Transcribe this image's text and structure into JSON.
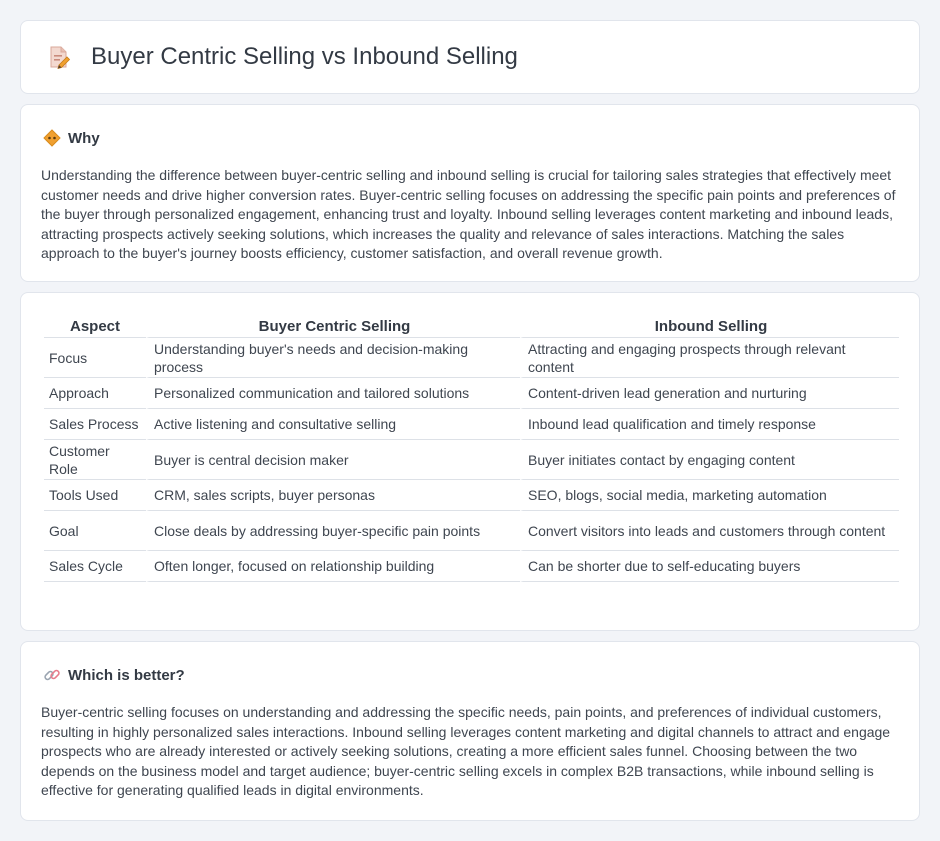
{
  "header": {
    "title": "Buyer Centric Selling vs Inbound Selling",
    "icon": "document-pencil-icon"
  },
  "why": {
    "heading": "Why",
    "icon": "diamond-sign-icon",
    "text": "Understanding the difference between buyer-centric selling and inbound selling is crucial for tailoring sales strategies that effectively meet customer needs and drive higher conversion rates. Buyer-centric selling focuses on addressing the specific pain points and preferences of the buyer through personalized engagement, enhancing trust and loyalty. Inbound selling leverages content marketing and inbound leads, attracting prospects actively seeking solutions, which increases the quality and relevance of sales interactions. Matching the sales approach to the buyer's journey boosts efficiency, customer satisfaction, and overall revenue growth."
  },
  "comparison": {
    "headers": [
      "Aspect",
      "Buyer Centric Selling",
      "Inbound Selling"
    ],
    "rows": [
      [
        "Focus",
        "Understanding buyer's needs and decision-making process",
        "Attracting and engaging prospects through relevant content"
      ],
      [
        "Approach",
        "Personalized communication and tailored solutions",
        "Content-driven lead generation and nurturing"
      ],
      [
        "Sales Process",
        "Active listening and consultative selling",
        "Inbound lead qualification and timely response"
      ],
      [
        "Customer Role",
        "Buyer is central decision maker",
        "Buyer initiates contact by engaging content"
      ],
      [
        "Tools Used",
        "CRM, sales scripts, buyer personas",
        "SEO, blogs, social media, marketing automation"
      ],
      [
        "Goal",
        "Close deals by addressing buyer-specific pain points",
        "Convert visitors into leads and customers through content"
      ],
      [
        "Sales Cycle",
        "Often longer, focused on relationship building",
        "Can be shorter due to self-educating buyers"
      ]
    ]
  },
  "better": {
    "heading": "Which is better?",
    "icon": "link-icon",
    "text": "Buyer-centric selling focuses on understanding and addressing the specific needs, pain points, and preferences of individual customers, resulting in highly personalized sales interactions. Inbound selling leverages content marketing and digital channels to attract and engage prospects who are already interested or actively seeking solutions, creating a more efficient sales funnel. Choosing between the two depends on the business model and target audience; buyer-centric selling excels in complex B2B transactions, while inbound selling is effective for generating qualified leads in digital environments."
  },
  "colors": {
    "background": "#f2f4f8",
    "card": "#ffffff",
    "border": "#e1e5ec",
    "icon_orange": "#f0a030",
    "icon_pink": "#e87c8c"
  }
}
